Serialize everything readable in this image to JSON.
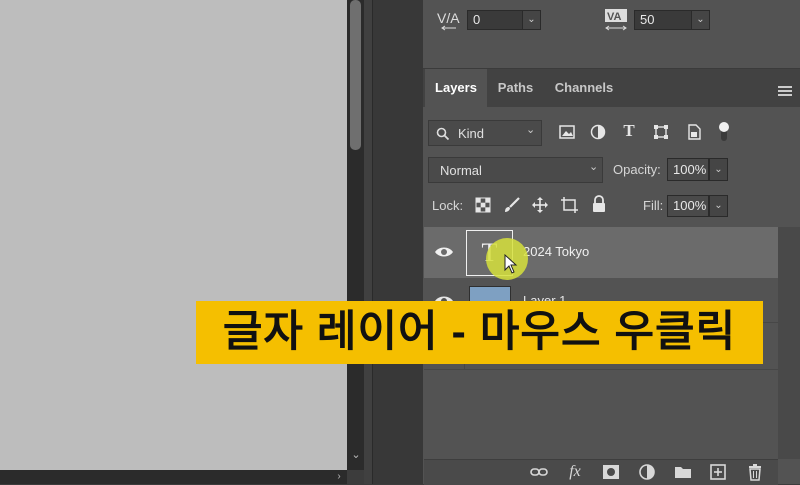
{
  "character": {
    "kerning_value": "0",
    "tracking_value": "50",
    "kerning_icon": "VA-kerning-icon",
    "tracking_icon": "VA-tracking-icon"
  },
  "tabs": [
    {
      "label": "Layers",
      "active": true
    },
    {
      "label": "Paths",
      "active": false
    },
    {
      "label": "Channels",
      "active": false
    }
  ],
  "filter": {
    "kind_label": "Kind"
  },
  "blend": {
    "mode": "Normal",
    "opacity_label": "Opacity:",
    "opacity_value": "100%"
  },
  "lock": {
    "label": "Lock:",
    "fill_label": "Fill:",
    "fill_value": "100%"
  },
  "layers": [
    {
      "name": "2024 Tokyo",
      "type": "text",
      "thumb_glyph": "T",
      "visible": true,
      "selected": true
    },
    {
      "name": "Layer 1",
      "type": "pixel",
      "visible": true,
      "selected": false
    }
  ],
  "caption": "글자 레이어 - 마우스 우클릭",
  "colors": {
    "canvas": "#bdbdbd",
    "panel": "#535353",
    "selected_row": "#6b6b6b",
    "caption_bg": "#f5bf00",
    "cursor_highlight": "#d6e13c"
  }
}
